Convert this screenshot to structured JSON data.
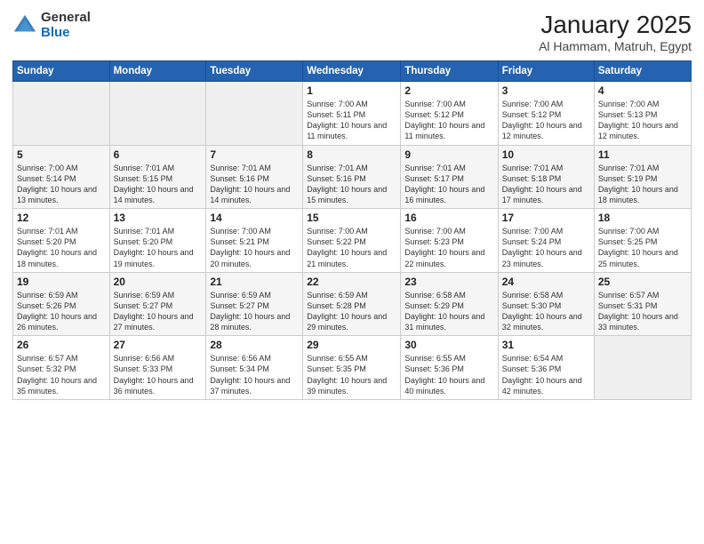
{
  "header": {
    "logo_general": "General",
    "logo_blue": "Blue",
    "month_title": "January 2025",
    "location": "Al Hammam, Matruh, Egypt"
  },
  "weekdays": [
    "Sunday",
    "Monday",
    "Tuesday",
    "Wednesday",
    "Thursday",
    "Friday",
    "Saturday"
  ],
  "weeks": [
    [
      {
        "day": "",
        "sunrise": "",
        "sunset": "",
        "daylight": "",
        "empty": true
      },
      {
        "day": "",
        "sunrise": "",
        "sunset": "",
        "daylight": "",
        "empty": true
      },
      {
        "day": "",
        "sunrise": "",
        "sunset": "",
        "daylight": "",
        "empty": true
      },
      {
        "day": "1",
        "sunrise": "Sunrise: 7:00 AM",
        "sunset": "Sunset: 5:11 PM",
        "daylight": "Daylight: 10 hours and 11 minutes."
      },
      {
        "day": "2",
        "sunrise": "Sunrise: 7:00 AM",
        "sunset": "Sunset: 5:12 PM",
        "daylight": "Daylight: 10 hours and 11 minutes."
      },
      {
        "day": "3",
        "sunrise": "Sunrise: 7:00 AM",
        "sunset": "Sunset: 5:12 PM",
        "daylight": "Daylight: 10 hours and 12 minutes."
      },
      {
        "day": "4",
        "sunrise": "Sunrise: 7:00 AM",
        "sunset": "Sunset: 5:13 PM",
        "daylight": "Daylight: 10 hours and 12 minutes."
      }
    ],
    [
      {
        "day": "5",
        "sunrise": "Sunrise: 7:00 AM",
        "sunset": "Sunset: 5:14 PM",
        "daylight": "Daylight: 10 hours and 13 minutes."
      },
      {
        "day": "6",
        "sunrise": "Sunrise: 7:01 AM",
        "sunset": "Sunset: 5:15 PM",
        "daylight": "Daylight: 10 hours and 14 minutes."
      },
      {
        "day": "7",
        "sunrise": "Sunrise: 7:01 AM",
        "sunset": "Sunset: 5:16 PM",
        "daylight": "Daylight: 10 hours and 14 minutes."
      },
      {
        "day": "8",
        "sunrise": "Sunrise: 7:01 AM",
        "sunset": "Sunset: 5:16 PM",
        "daylight": "Daylight: 10 hours and 15 minutes."
      },
      {
        "day": "9",
        "sunrise": "Sunrise: 7:01 AM",
        "sunset": "Sunset: 5:17 PM",
        "daylight": "Daylight: 10 hours and 16 minutes."
      },
      {
        "day": "10",
        "sunrise": "Sunrise: 7:01 AM",
        "sunset": "Sunset: 5:18 PM",
        "daylight": "Daylight: 10 hours and 17 minutes."
      },
      {
        "day": "11",
        "sunrise": "Sunrise: 7:01 AM",
        "sunset": "Sunset: 5:19 PM",
        "daylight": "Daylight: 10 hours and 18 minutes."
      }
    ],
    [
      {
        "day": "12",
        "sunrise": "Sunrise: 7:01 AM",
        "sunset": "Sunset: 5:20 PM",
        "daylight": "Daylight: 10 hours and 18 minutes."
      },
      {
        "day": "13",
        "sunrise": "Sunrise: 7:01 AM",
        "sunset": "Sunset: 5:20 PM",
        "daylight": "Daylight: 10 hours and 19 minutes."
      },
      {
        "day": "14",
        "sunrise": "Sunrise: 7:00 AM",
        "sunset": "Sunset: 5:21 PM",
        "daylight": "Daylight: 10 hours and 20 minutes."
      },
      {
        "day": "15",
        "sunrise": "Sunrise: 7:00 AM",
        "sunset": "Sunset: 5:22 PM",
        "daylight": "Daylight: 10 hours and 21 minutes."
      },
      {
        "day": "16",
        "sunrise": "Sunrise: 7:00 AM",
        "sunset": "Sunset: 5:23 PM",
        "daylight": "Daylight: 10 hours and 22 minutes."
      },
      {
        "day": "17",
        "sunrise": "Sunrise: 7:00 AM",
        "sunset": "Sunset: 5:24 PM",
        "daylight": "Daylight: 10 hours and 23 minutes."
      },
      {
        "day": "18",
        "sunrise": "Sunrise: 7:00 AM",
        "sunset": "Sunset: 5:25 PM",
        "daylight": "Daylight: 10 hours and 25 minutes."
      }
    ],
    [
      {
        "day": "19",
        "sunrise": "Sunrise: 6:59 AM",
        "sunset": "Sunset: 5:26 PM",
        "daylight": "Daylight: 10 hours and 26 minutes."
      },
      {
        "day": "20",
        "sunrise": "Sunrise: 6:59 AM",
        "sunset": "Sunset: 5:27 PM",
        "daylight": "Daylight: 10 hours and 27 minutes."
      },
      {
        "day": "21",
        "sunrise": "Sunrise: 6:59 AM",
        "sunset": "Sunset: 5:27 PM",
        "daylight": "Daylight: 10 hours and 28 minutes."
      },
      {
        "day": "22",
        "sunrise": "Sunrise: 6:59 AM",
        "sunset": "Sunset: 5:28 PM",
        "daylight": "Daylight: 10 hours and 29 minutes."
      },
      {
        "day": "23",
        "sunrise": "Sunrise: 6:58 AM",
        "sunset": "Sunset: 5:29 PM",
        "daylight": "Daylight: 10 hours and 31 minutes."
      },
      {
        "day": "24",
        "sunrise": "Sunrise: 6:58 AM",
        "sunset": "Sunset: 5:30 PM",
        "daylight": "Daylight: 10 hours and 32 minutes."
      },
      {
        "day": "25",
        "sunrise": "Sunrise: 6:57 AM",
        "sunset": "Sunset: 5:31 PM",
        "daylight": "Daylight: 10 hours and 33 minutes."
      }
    ],
    [
      {
        "day": "26",
        "sunrise": "Sunrise: 6:57 AM",
        "sunset": "Sunset: 5:32 PM",
        "daylight": "Daylight: 10 hours and 35 minutes."
      },
      {
        "day": "27",
        "sunrise": "Sunrise: 6:56 AM",
        "sunset": "Sunset: 5:33 PM",
        "daylight": "Daylight: 10 hours and 36 minutes."
      },
      {
        "day": "28",
        "sunrise": "Sunrise: 6:56 AM",
        "sunset": "Sunset: 5:34 PM",
        "daylight": "Daylight: 10 hours and 37 minutes."
      },
      {
        "day": "29",
        "sunrise": "Sunrise: 6:55 AM",
        "sunset": "Sunset: 5:35 PM",
        "daylight": "Daylight: 10 hours and 39 minutes."
      },
      {
        "day": "30",
        "sunrise": "Sunrise: 6:55 AM",
        "sunset": "Sunset: 5:36 PM",
        "daylight": "Daylight: 10 hours and 40 minutes."
      },
      {
        "day": "31",
        "sunrise": "Sunrise: 6:54 AM",
        "sunset": "Sunset: 5:36 PM",
        "daylight": "Daylight: 10 hours and 42 minutes."
      },
      {
        "day": "",
        "sunrise": "",
        "sunset": "",
        "daylight": "",
        "empty": true
      }
    ]
  ]
}
